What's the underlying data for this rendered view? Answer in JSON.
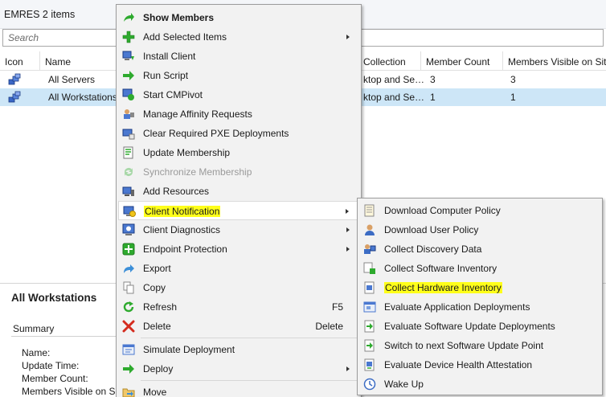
{
  "collection_title": "EMRES 2 items",
  "search": {
    "placeholder": "Search"
  },
  "grid": {
    "headers": [
      "Icon",
      "Name",
      "Collection",
      "Member Count",
      "Members Visible on Site"
    ],
    "rows": [
      {
        "name": "All Servers",
        "collection": "ktop and Se…",
        "member_count": "3",
        "members_visible": "3"
      },
      {
        "name": "All Workstations",
        "collection": "ktop and Se…",
        "member_count": "1",
        "members_visible": "1"
      }
    ]
  },
  "details": {
    "title": "All Workstations",
    "summary_label": "Summary",
    "fields": [
      "Name:",
      "Update Time:",
      "Member Count:",
      "Members Visible on Sit"
    ]
  },
  "context_menu": {
    "items": [
      {
        "label": "Show Members",
        "icon": "show-members-arrow-icon",
        "bold": true
      },
      {
        "label": "Add Selected Items",
        "icon": "add-plus-icon",
        "submenu": true
      },
      {
        "label": "Install Client",
        "icon": "install-client-icon"
      },
      {
        "label": "Run Script",
        "icon": "run-script-arrow-icon"
      },
      {
        "label": "Start CMPivot",
        "icon": "cmpivot-icon"
      },
      {
        "label": "Manage Affinity Requests",
        "icon": "affinity-requests-icon"
      },
      {
        "label": "Clear Required PXE Deployments",
        "icon": "clear-pxe-icon"
      },
      {
        "label": "Update Membership",
        "icon": "update-membership-icon"
      },
      {
        "label": "Synchronize Membership",
        "icon": "synchronize-icon",
        "disabled": true
      },
      {
        "label": "Add Resources",
        "icon": "add-resources-icon"
      },
      {
        "label": "Client Notification",
        "icon": "client-notification-icon",
        "submenu": true,
        "highlighted": true
      },
      {
        "label": "Client Diagnostics",
        "icon": "client-diagnostics-icon",
        "submenu": true
      },
      {
        "label": "Endpoint Protection",
        "icon": "endpoint-protection-icon",
        "submenu": true
      },
      {
        "label": "Export",
        "icon": "export-arrow-icon"
      },
      {
        "label": "Copy",
        "icon": "copy-icon"
      },
      {
        "label": "Refresh",
        "icon": "refresh-icon",
        "shortcut": "F5"
      },
      {
        "label": "Delete",
        "icon": "delete-x-icon",
        "shortcut": "Delete"
      },
      {
        "label": "Simulate Deployment",
        "icon": "simulate-deployment-icon"
      },
      {
        "label": "Deploy",
        "icon": "deploy-arrow-icon",
        "submenu": true
      },
      {
        "label": "Move",
        "icon": "move-folder-icon"
      }
    ]
  },
  "client_notification_menu": {
    "items": [
      {
        "label": "Download Computer Policy",
        "icon": "computer-policy-icon"
      },
      {
        "label": "Download User Policy",
        "icon": "user-policy-icon"
      },
      {
        "label": "Collect Discovery Data",
        "icon": "discovery-data-icon"
      },
      {
        "label": "Collect Software Inventory",
        "icon": "software-inventory-icon"
      },
      {
        "label": "Collect Hardware Inventory",
        "icon": "hardware-inventory-icon",
        "highlighted": true
      },
      {
        "label": "Evaluate Application Deployments",
        "icon": "application-deployments-icon"
      },
      {
        "label": "Evaluate Software Update Deployments",
        "icon": "software-update-deployments-icon"
      },
      {
        "label": "Switch to next Software Update Point",
        "icon": "switch-update-point-icon"
      },
      {
        "label": "Evaluate Device Health Attestation",
        "icon": "device-health-icon"
      },
      {
        "label": "Wake Up",
        "icon": "wake-up-clock-icon"
      }
    ]
  },
  "colors": {
    "selection": "#cde6f7",
    "highlight": "#ffff1a",
    "menu_background": "#f2f2f2",
    "green": "#2eaa2e",
    "red": "#d42b1e",
    "blue": "#2e63b8"
  }
}
